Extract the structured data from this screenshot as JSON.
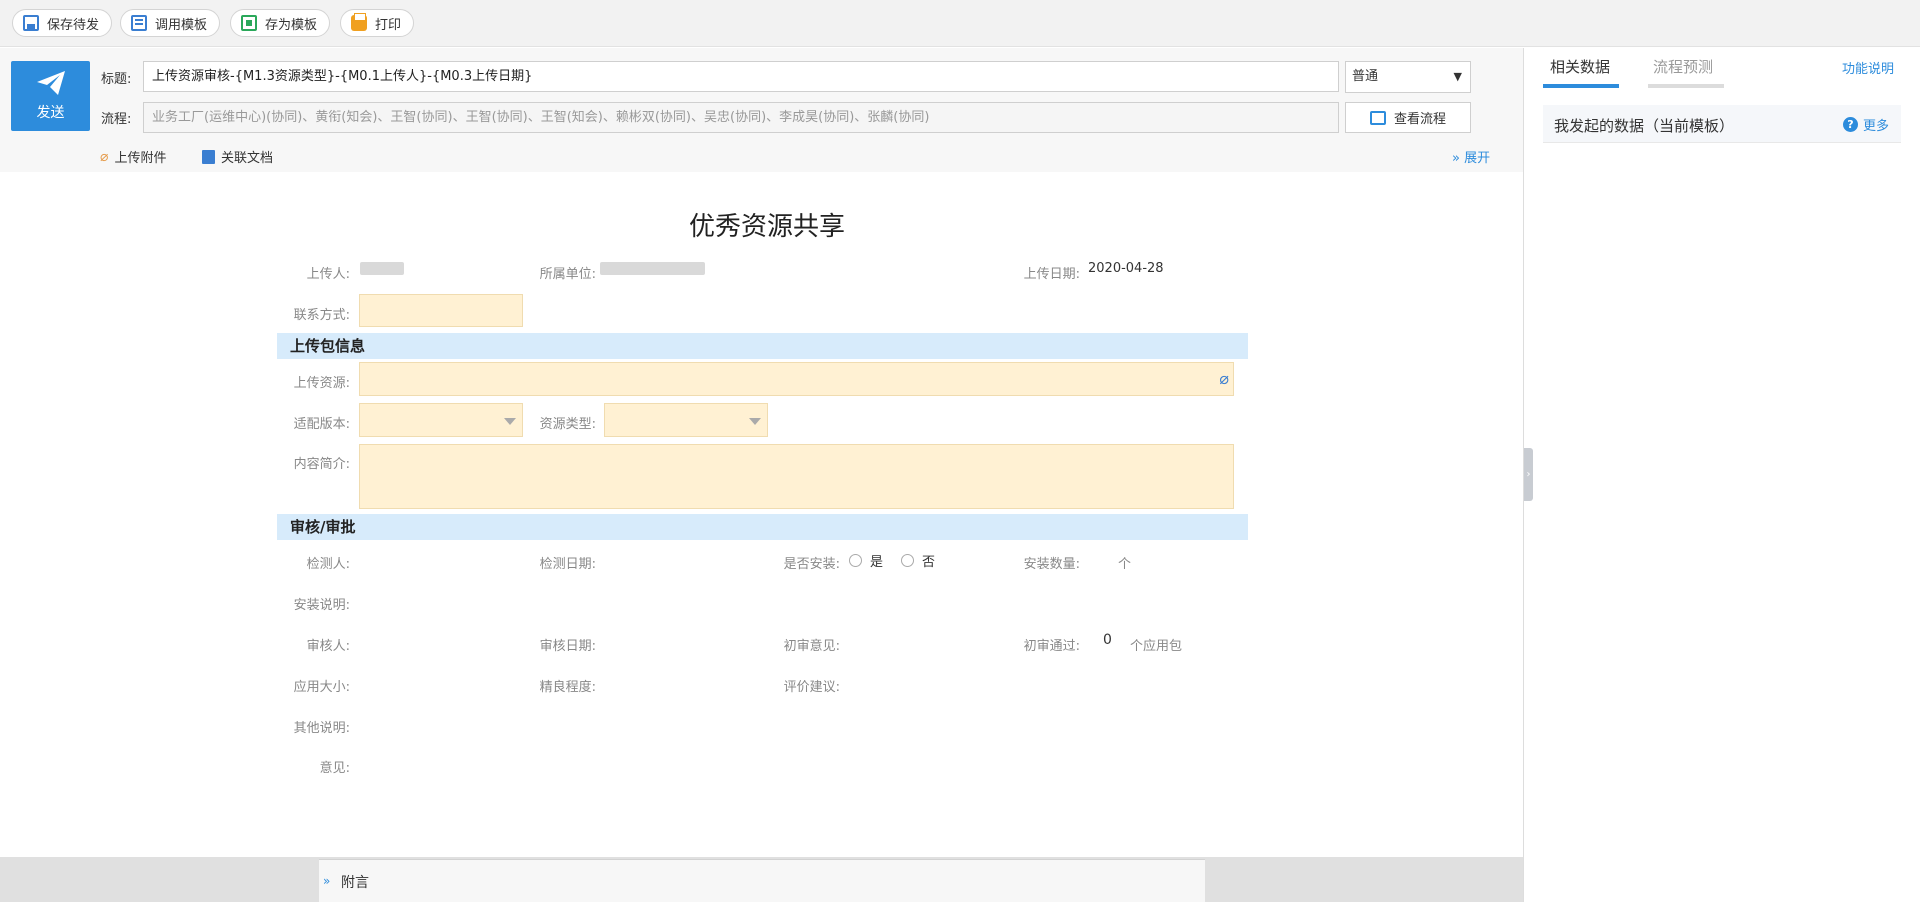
{
  "toolbar": {
    "save_draft": "保存待发",
    "use_template": "调用模板",
    "save_template": "存为模板",
    "print": "打印"
  },
  "header": {
    "send_label": "发送",
    "title_label": "标题:",
    "title_value": "上传资源审核-{M1.3资源类型}-{M0.1上传人}-{M0.3上传日期}",
    "priority_value": "普通",
    "flow_label": "流程:",
    "flow_value": "业务工厂(运维中心)(协同)、黄衔(知会)、王智(协同)、王智(协同)、王智(知会)、赖彬双(协同)、吴忠(协同)、李成昊(协同)、张麟(协同)",
    "view_flow": "查看流程",
    "upload_attachment": "上传附件",
    "related_doc": "关联文档",
    "expand": "展开"
  },
  "form": {
    "title": "优秀资源共享",
    "uploader_label": "上传人:",
    "unit_label": "所属单位:",
    "upload_date_label": "上传日期:",
    "upload_date_value": "2020-04-28",
    "contact_label": "联系方式:",
    "section_upload": "上传包信息",
    "upload_resource_label": "上传资源:",
    "version_label": "适配版本:",
    "resource_type_label": "资源类型:",
    "summary_label": "内容简介:",
    "section_review": "审核/审批",
    "inspector_label": "检测人:",
    "inspect_date_label": "检测日期:",
    "installed_label": "是否安装:",
    "yes": "是",
    "no": "否",
    "install_count_label": "安装数量:",
    "install_unit": "个",
    "install_note_label": "安装说明:",
    "reviewer_label": "审核人:",
    "review_date_label": "审核日期:",
    "first_opinion_label": "初审意见:",
    "first_pass_label": "初审通过:",
    "first_pass_value": "0",
    "first_pass_unit": "个应用包",
    "app_size_label": "应用大小:",
    "quality_label": "精良程度:",
    "eval_label": "评价建议:",
    "other_note_label": "其他说明:",
    "opinion_label": "意见:"
  },
  "bottom": {
    "postscript": "附言"
  },
  "right_panel": {
    "tab_related": "相关数据",
    "tab_forecast": "流程预测",
    "func_desc": "功能说明",
    "my_data": "我发起的数据（当前模板）",
    "more": "更多"
  },
  "colors": {
    "accent": "#2d8cdc",
    "input_yellow": "#fff1d3",
    "section_blue": "#d7ebfb"
  }
}
